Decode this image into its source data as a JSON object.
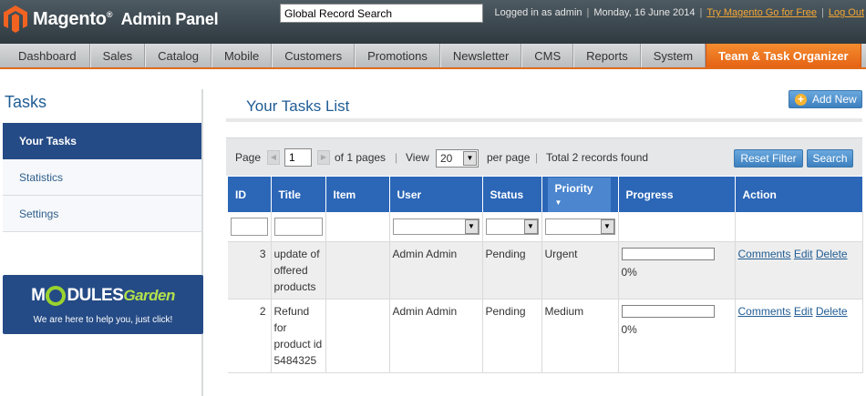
{
  "header": {
    "app_name": "Magento",
    "app_sub": "Admin Panel",
    "search_value": "Global Record Search",
    "logged_in": "Logged in as admin",
    "date": "Monday, 16 June 2014",
    "try_link": "Try Magento Go for Free",
    "logout": "Log Out",
    "accent": "#f5a836"
  },
  "nav": {
    "items": [
      "Dashboard",
      "Sales",
      "Catalog",
      "Mobile",
      "Customers",
      "Promotions",
      "Newsletter",
      "CMS",
      "Reports",
      "System",
      "Team & Task Organizer"
    ],
    "active_index": 10
  },
  "sidebar": {
    "title": "Tasks",
    "tabs": [
      "Your Tasks",
      "Statistics",
      "Settings"
    ],
    "banner_logo_a": "M",
    "banner_logo_b": "DULES",
    "banner_logo_c": "Garden",
    "banner_tag": "We are here to help you, just click!"
  },
  "main": {
    "title": "Your Tasks List",
    "add_button": "Add New"
  },
  "pager": {
    "page_label": "Page",
    "page_value": "1",
    "of_pages": "of 1 pages",
    "view_label": "View",
    "view_value": "20",
    "per_page": "per page",
    "total": "Total 2 records found",
    "reset_button": "Reset Filter",
    "search_button": "Search"
  },
  "grid": {
    "columns": [
      "ID",
      "Title",
      "Item",
      "User",
      "Status",
      "Priority",
      "Progress",
      "Action"
    ],
    "rows": [
      {
        "id": "3",
        "title": "update of offered products",
        "item": "",
        "user": "Admin Admin",
        "status": "Pending",
        "priority": "Urgent",
        "progress_value": 0,
        "progress": "0%",
        "actions": [
          "Comments",
          "Edit",
          "Delete"
        ]
      },
      {
        "id": "2",
        "title": "Refund for product id 5484325",
        "item": "",
        "user": "Admin Admin",
        "status": "Pending",
        "priority": "Medium",
        "progress_value": 0,
        "progress": "0%",
        "actions": [
          "Comments",
          "Edit",
          "Delete"
        ]
      }
    ]
  }
}
